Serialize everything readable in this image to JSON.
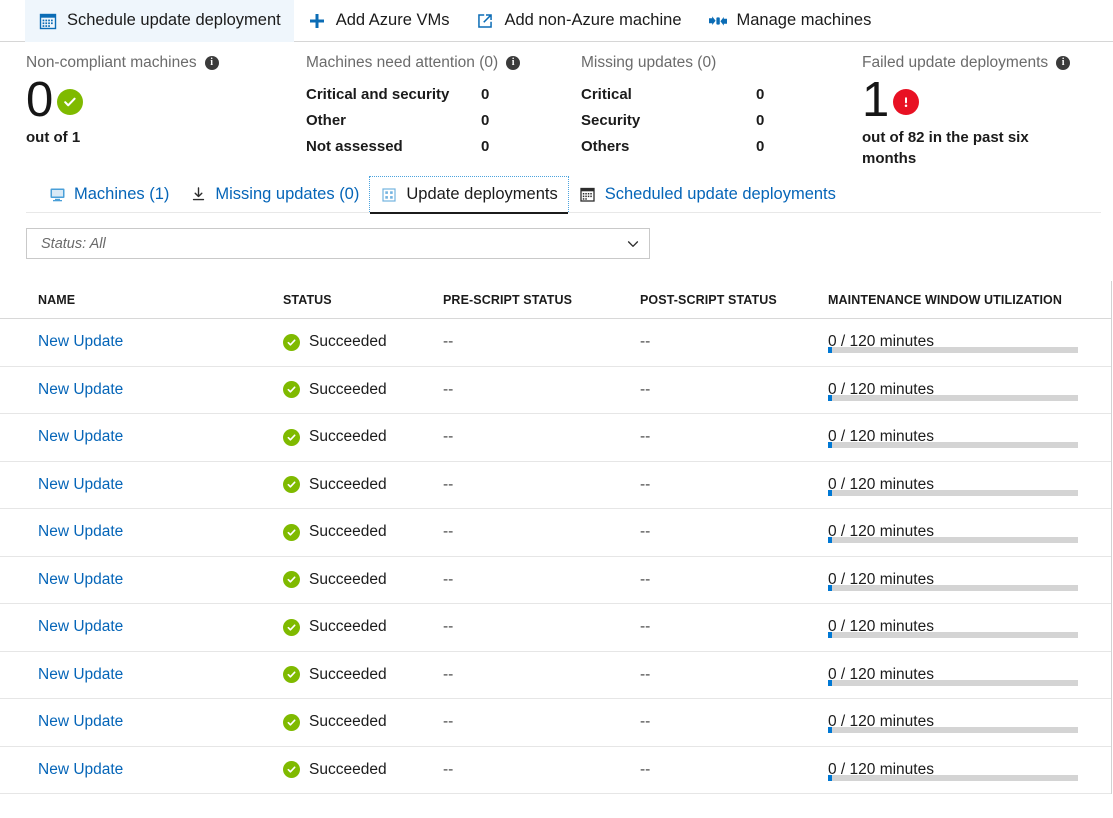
{
  "commandbar": {
    "items": [
      {
        "label": "Schedule update deployment",
        "icon": "calendar-icon",
        "active": true
      },
      {
        "label": "Add Azure VMs",
        "icon": "plus-icon",
        "active": false
      },
      {
        "label": "Add non-Azure machine",
        "icon": "external-link-icon",
        "active": false
      },
      {
        "label": "Manage machines",
        "icon": "connector-icon",
        "active": false
      }
    ]
  },
  "tiles": {
    "non_compliant": {
      "title": "Non-compliant machines",
      "value": "0",
      "subtitle": "out of 1",
      "status": "ok",
      "status_color": "#7fba00"
    },
    "need_attention": {
      "title": "Machines need attention (0)",
      "rows": [
        {
          "key": "Critical and security",
          "value": "0"
        },
        {
          "key": "Other",
          "value": "0"
        },
        {
          "key": "Not assessed",
          "value": "0"
        }
      ]
    },
    "missing_updates": {
      "title": "Missing updates (0)",
      "rows": [
        {
          "key": "Critical",
          "value": "0"
        },
        {
          "key": "Security",
          "value": "0"
        },
        {
          "key": "Others",
          "value": "0"
        }
      ]
    },
    "failed_deployments": {
      "title": "Failed update deployments",
      "value": "1",
      "subtitle": "out of 82 in the past six months",
      "status": "error",
      "status_color": "#e81123"
    }
  },
  "tabs": [
    {
      "label": "Machines (1)",
      "icon": "monitor-icon",
      "selected": false
    },
    {
      "label": "Missing updates (0)",
      "icon": "download-icon",
      "selected": false
    },
    {
      "label": "Update deployments",
      "icon": "grid-icon",
      "selected": true
    },
    {
      "label": "Scheduled update deployments",
      "icon": "calendar-icon",
      "selected": false
    }
  ],
  "filter": {
    "value": "Status: All",
    "icon": "chevron-down-icon"
  },
  "table": {
    "columns": [
      "NAME",
      "STATUS",
      "PRE-SCRIPT STATUS",
      "POST-SCRIPT STATUS",
      "MAINTENANCE WINDOW UTILIZATION"
    ],
    "rows": [
      {
        "name": "New Update",
        "status": "Succeeded",
        "pre_script": "--",
        "post_script": "--",
        "maintenance_window": "0 / 120 minutes"
      },
      {
        "name": "New Update",
        "status": "Succeeded",
        "pre_script": "--",
        "post_script": "--",
        "maintenance_window": "0 / 120 minutes"
      },
      {
        "name": "New Update",
        "status": "Succeeded",
        "pre_script": "--",
        "post_script": "--",
        "maintenance_window": "0 / 120 minutes"
      },
      {
        "name": "New Update",
        "status": "Succeeded",
        "pre_script": "--",
        "post_script": "--",
        "maintenance_window": "0 / 120 minutes"
      },
      {
        "name": "New Update",
        "status": "Succeeded",
        "pre_script": "--",
        "post_script": "--",
        "maintenance_window": "0 / 120 minutes"
      },
      {
        "name": "New Update",
        "status": "Succeeded",
        "pre_script": "--",
        "post_script": "--",
        "maintenance_window": "0 / 120 minutes"
      },
      {
        "name": "New Update",
        "status": "Succeeded",
        "pre_script": "--",
        "post_script": "--",
        "maintenance_window": "0 / 120 minutes"
      },
      {
        "name": "New Update",
        "status": "Succeeded",
        "pre_script": "--",
        "post_script": "--",
        "maintenance_window": "0 / 120 minutes"
      },
      {
        "name": "New Update",
        "status": "Succeeded",
        "pre_script": "--",
        "post_script": "--",
        "maintenance_window": "0 / 120 minutes"
      },
      {
        "name": "New Update",
        "status": "Succeeded",
        "pre_script": "--",
        "post_script": "--",
        "maintenance_window": "0 / 120 minutes"
      }
    ]
  },
  "colors": {
    "link": "#0565b8",
    "success": "#7fba00",
    "error": "#e81123",
    "accent": "#0078d4",
    "command_active_bg": "#eff6fc"
  }
}
